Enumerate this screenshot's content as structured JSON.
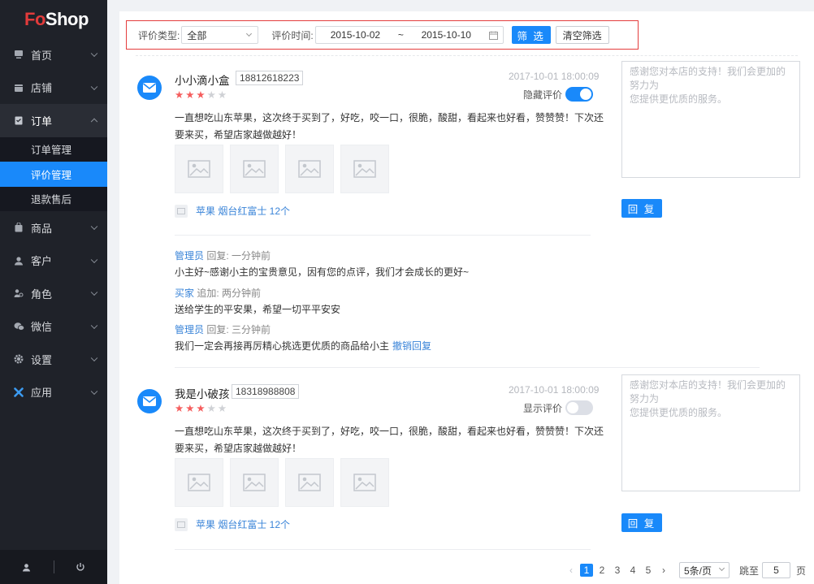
{
  "brand": {
    "logo_fo": "Fo",
    "logo_shop": "Shop"
  },
  "sidebar": {
    "items": [
      {
        "label": "首页",
        "icon": "monitor-icon"
      },
      {
        "label": "店铺",
        "icon": "store-icon"
      },
      {
        "label": "订单",
        "icon": "clipboard-icon"
      },
      {
        "label": "商品",
        "icon": "bag-icon"
      },
      {
        "label": "客户",
        "icon": "user-icon"
      },
      {
        "label": "角色",
        "icon": "role-icon"
      },
      {
        "label": "微信",
        "icon": "wechat-icon"
      },
      {
        "label": "设置",
        "icon": "gear-icon"
      },
      {
        "label": "应用",
        "icon": "app-icon"
      }
    ],
    "order_sub": [
      "订单管理",
      "评价管理",
      "退款售后"
    ]
  },
  "filter": {
    "type_label": "评价类型:",
    "type_value": "全部",
    "time_label": "评价时间:",
    "date_from": "2015-10-02",
    "date_sep": "~",
    "date_to": "2015-10-10",
    "filter_btn": "筛 选",
    "clear_btn": "清空筛选"
  },
  "reviews": [
    {
      "user": "小小滴小盒",
      "phone": "18812618223",
      "stars": 3,
      "time": "2017-10-01 18:00:09",
      "toggle_label": "隐藏评价",
      "text": "一直想吃山东苹果，这次终于买到了，好吃，咬一口，很脆，酸甜，看起来也好看，赞赞赞！下次还要来买，希望店家越做越好！",
      "product": "苹果 烟台红富士 12个",
      "reply_placeholder": "感谢您对本店的支持！我们会更加的努力为\n您提供更优质的服务。",
      "reply_btn": "回 复",
      "conversation": [
        {
          "who": "管理员",
          "action": "回复:",
          "time": "一分钟前",
          "msg": "小主好~感谢小主的宝贵意见，因有您的点评，我们才会成长的更好~"
        },
        {
          "who": "买家",
          "action": "追加:",
          "time": "两分钟前",
          "msg": "送给学生的平安果，希望一切平平安安"
        },
        {
          "who": "管理员",
          "action": "回复:",
          "time": "三分钟前",
          "msg": "我们一定会再接再厉精心挑选更优质的商品给小主",
          "link": "撤销回复"
        }
      ]
    },
    {
      "user": "我是小破孩",
      "phone": "18318988808",
      "stars": 3,
      "time": "2017-10-01 18:00:09",
      "toggle_label": "显示评价",
      "text": "一直想吃山东苹果，这次终于买到了，好吃，咬一口，很脆，酸甜，看起来也好看，赞赞赞！下次还要来买，希望店家越做越好！",
      "product": "苹果 烟台红富士 12个",
      "reply_placeholder": "感谢您对本店的支持！我们会更加的努力为\n您提供更优质的服务。",
      "reply_btn": "回 复"
    }
  ],
  "pagination": {
    "prev": "‹",
    "pages": [
      "1",
      "2",
      "3",
      "4",
      "5"
    ],
    "next": "›",
    "page_size": "5条/页",
    "jump_label": "跳至",
    "jump_value": "5",
    "page_unit": "页"
  },
  "colors": {
    "accent": "#1989fa",
    "sidebar": "#1f2229",
    "star": "#f55d5d",
    "filter_border": "#e43d3d"
  }
}
